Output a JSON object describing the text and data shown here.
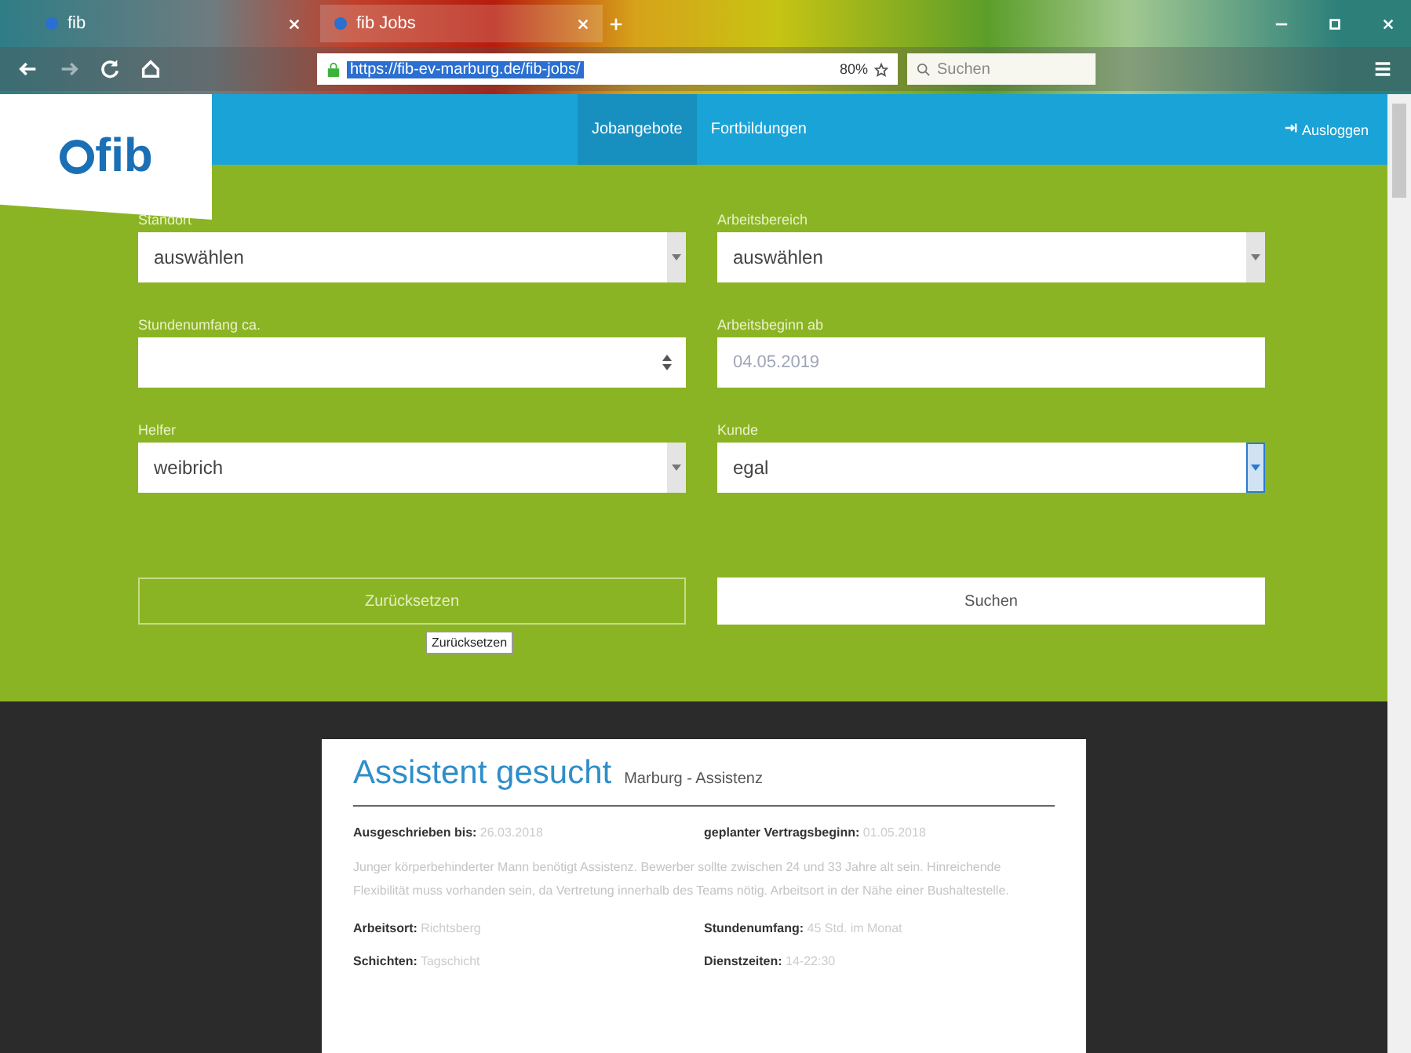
{
  "browser": {
    "tabs": [
      {
        "title": "fib",
        "selected": false
      },
      {
        "title": "fib Jobs",
        "selected": true
      }
    ],
    "url": "https://fib-ev-marburg.de/fib-jobs/",
    "zoom": "80%",
    "search": {
      "placeholder": "Suchen"
    }
  },
  "header": {
    "logo": "fib",
    "nav": [
      {
        "label": "Jobangebote",
        "selected": true
      },
      {
        "label": "Fortbildungen",
        "selected": false
      }
    ],
    "logout": "Ausloggen"
  },
  "filters": [
    {
      "label": "Standort",
      "kind": "select",
      "value": "auswählen",
      "focused": false
    },
    {
      "label": "Arbeitsbereich",
      "kind": "select",
      "value": "auswählen",
      "focused": false
    },
    {
      "label": "Stundenumfang ca.",
      "kind": "number"
    },
    {
      "label": "Arbeitsbeginn ab",
      "kind": "date",
      "placeholder": "04.05.2019"
    },
    {
      "label": "Helfer",
      "kind": "select",
      "value": "weibrich",
      "focused": false
    },
    {
      "label": "Kunde",
      "kind": "select",
      "value": "egal",
      "focused": true
    }
  ],
  "buttons": {
    "reset": "Zurücksetzen",
    "search": "Suchen",
    "tooltip": "Zurücksetzen"
  },
  "job": {
    "title": "Assistent gesucht",
    "subtitle": "Marburg - Assistenz",
    "top_facts": [
      {
        "label": "Ausgeschrieben bis:",
        "value": "26.03.2018"
      },
      {
        "label": "geplanter Vertragsbeginn:",
        "value": "01.05.2018"
      }
    ],
    "description": "Junger körperbehinderter Mann benötigt Assistenz. Bewerber sollte zwischen 24 und 33 Jahre alt sein. Hinreichende Flexibilität muss vorhanden sein, da Vertretung innerhalb des Teams nötig. Arbeitsort in der Nähe einer Bushaltestelle.",
    "facts": [
      {
        "label": "Arbeitsort:",
        "value": "Richtsberg"
      },
      {
        "label": "Stundenumfang:",
        "value": "45 Std. im Monat"
      },
      {
        "label": "Schichten:",
        "value": "Tagschicht"
      },
      {
        "label": "Dienstzeiten:",
        "value": "14-22:30"
      }
    ]
  }
}
